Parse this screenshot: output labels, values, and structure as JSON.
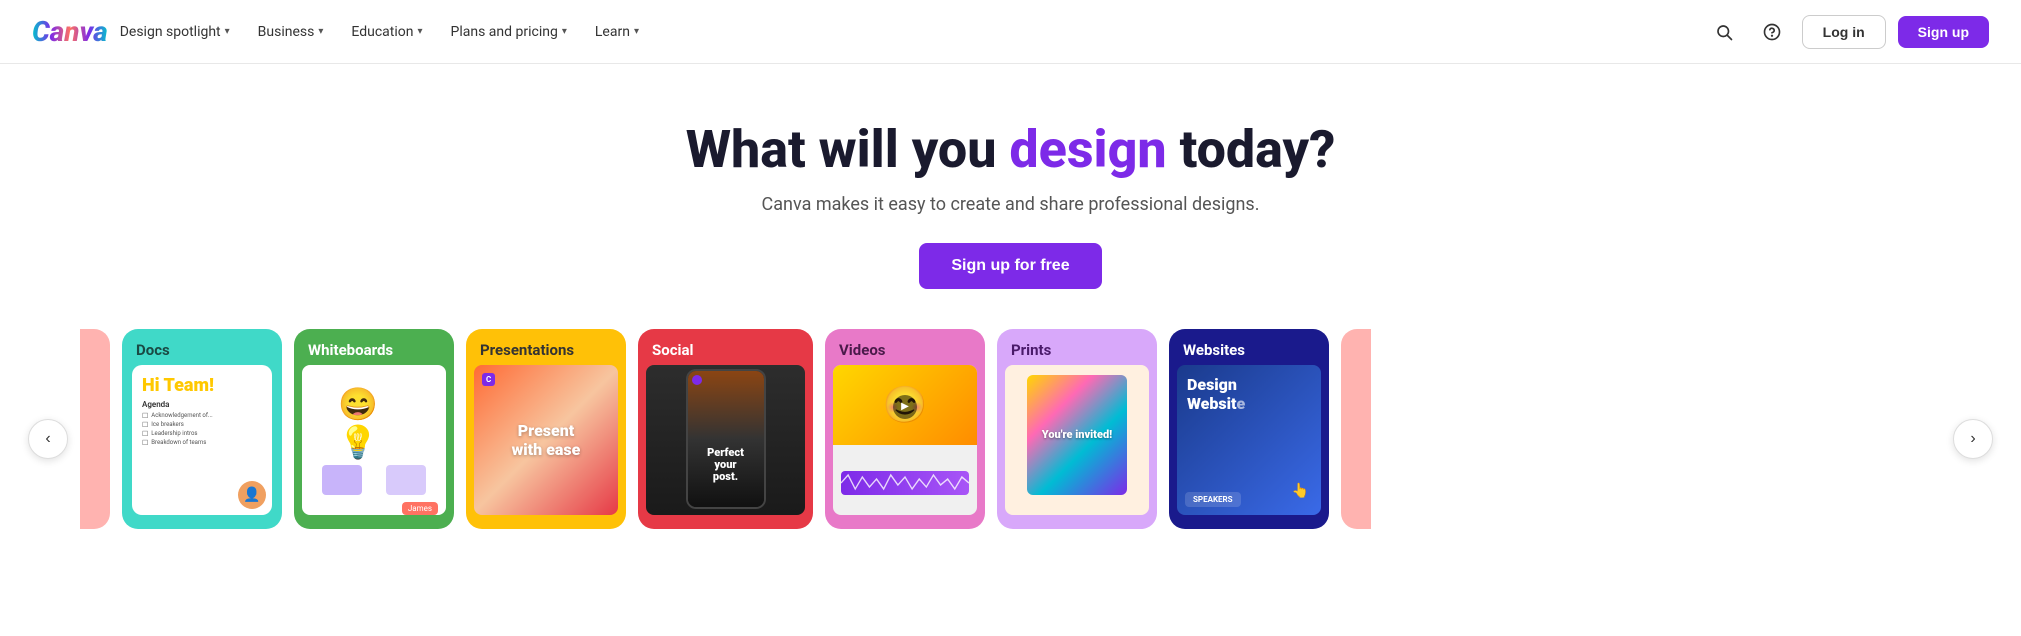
{
  "nav": {
    "logo": "Canva",
    "links": [
      {
        "label": "Design spotlight",
        "has_dropdown": true
      },
      {
        "label": "Business",
        "has_dropdown": true
      },
      {
        "label": "Education",
        "has_dropdown": true
      },
      {
        "label": "Plans and pricing",
        "has_dropdown": true
      },
      {
        "label": "Learn",
        "has_dropdown": true
      }
    ],
    "search_title": "Search",
    "help_title": "Help",
    "login_label": "Log in",
    "signup_label": "Sign up"
  },
  "hero": {
    "heading_prefix": "What will you ",
    "heading_highlight": "design",
    "heading_suffix": " today?",
    "subtext": "Canva makes it easy to create and share professional designs.",
    "cta_label": "Sign up for free"
  },
  "cards": [
    {
      "id": "docs",
      "label": "Docs",
      "bg": "#40d9c8",
      "label_color": "#1a4a44"
    },
    {
      "id": "whiteboards",
      "label": "Whiteboards",
      "bg": "#4caf50",
      "label_color": "#fff"
    },
    {
      "id": "presentations",
      "label": "Presentations",
      "bg": "#ffc107",
      "label_color": "#333"
    },
    {
      "id": "social",
      "label": "Social",
      "bg": "#e63946",
      "label_color": "#fff"
    },
    {
      "id": "videos",
      "label": "Videos",
      "bg": "#e879c8",
      "label_color": "#4a1a4a"
    },
    {
      "id": "prints",
      "label": "Prints",
      "bg": "#d8a8fa",
      "label_color": "#4a1a6a"
    },
    {
      "id": "websites",
      "label": "Websites",
      "bg": "#1a1a8c",
      "label_color": "#fff"
    }
  ],
  "presentations_card": {
    "line1": "Present",
    "line2": "with ease"
  },
  "social_card": {
    "text1": "Perfect",
    "text2": "your",
    "text3": "post."
  },
  "docs_card": {
    "heading": "Hi Team!",
    "agenda_label": "Agenda",
    "items": [
      "Acknowledgement of...",
      "Ice breakers",
      "Leadership intros",
      "Breakdown of teams"
    ]
  },
  "websites_card": {
    "text": "Design Websit..."
  },
  "prints_card": {
    "text": "You're invited!"
  },
  "carousel": {
    "prev_label": "‹",
    "next_label": "›"
  }
}
